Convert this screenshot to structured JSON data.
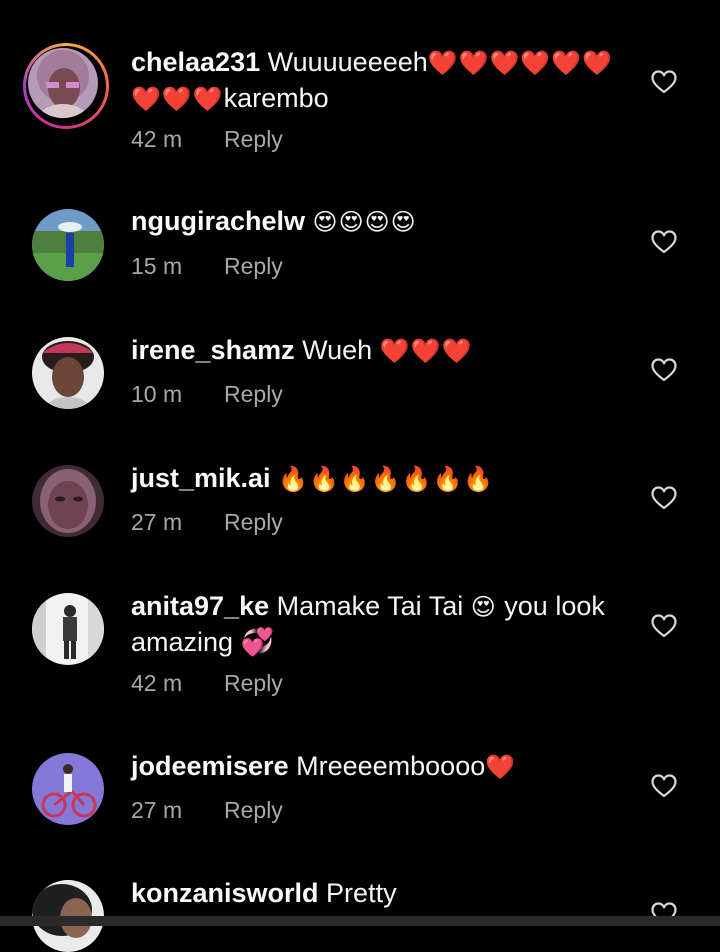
{
  "comments": [
    {
      "username": "chelaa231",
      "text": "Wuuuueeeeh",
      "emoji": "❤️❤️❤️❤️❤️❤️❤️❤️❤️",
      "text_after": "karembo",
      "time": "42 m",
      "reply": "Reply"
    },
    {
      "username": "ngugirachelw",
      "text": "",
      "emoji": "😍😍😍😍",
      "text_after": "",
      "time": "15 m",
      "reply": "Reply"
    },
    {
      "username": "irene_shamz",
      "text": "Wueh",
      "emoji": "❤️❤️❤️",
      "text_after": "",
      "time": "10 m",
      "reply": "Reply"
    },
    {
      "username": "just_mik.ai",
      "text": "",
      "emoji": "🔥🔥🔥🔥🔥🔥🔥",
      "text_after": "",
      "time": "27 m",
      "reply": "Reply"
    },
    {
      "username": "anita97_ke",
      "text": "Mamake Tai Tai",
      "emoji": "😍",
      "text_after": "you look amazing 💞",
      "time": "42 m",
      "reply": "Reply"
    },
    {
      "username": "jodeemisere",
      "text": "Mreeeemboooo",
      "emoji": "❤️",
      "text_after": "",
      "time": "27 m",
      "reply": "Reply"
    },
    {
      "username": "konzanisworld",
      "text": "Pretty",
      "emoji": "",
      "text_after": "",
      "time": "",
      "reply": ""
    }
  ],
  "colors": {
    "background": "#000000",
    "meta_text": "#a8a8a8",
    "story_ring": [
      "#f8b03a",
      "#d62f84"
    ]
  },
  "icons": {
    "like": "heart-outline-icon"
  }
}
